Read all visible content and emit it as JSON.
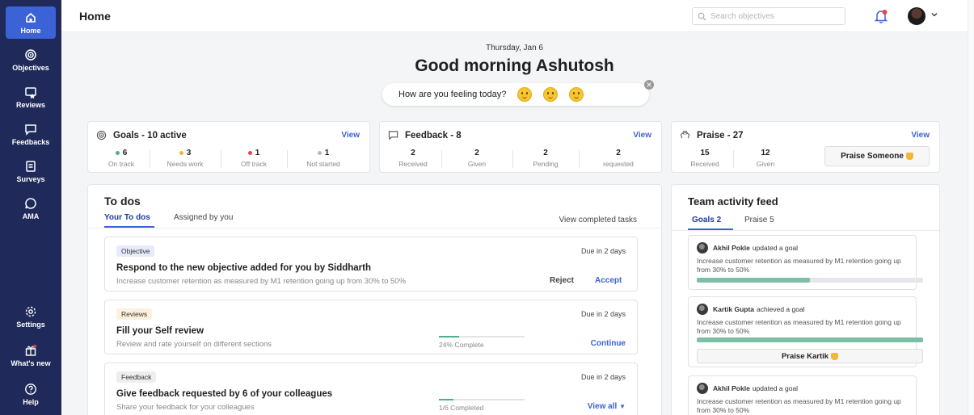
{
  "sidebar": {
    "items": [
      {
        "label": "Home",
        "icon": "home-icon"
      },
      {
        "label": "Objectives",
        "icon": "target-icon"
      },
      {
        "label": "Reviews",
        "icon": "reviews-icon"
      },
      {
        "label": "Feedbacks",
        "icon": "chat-icon"
      },
      {
        "label": "Surveys",
        "icon": "survey-icon"
      },
      {
        "label": "AMA",
        "icon": "ama-icon"
      }
    ],
    "bottom": [
      {
        "label": "Settings",
        "icon": "gear-icon"
      },
      {
        "label": "What's new",
        "icon": "gift-icon"
      },
      {
        "label": "Help",
        "icon": "help-icon"
      }
    ],
    "colors": {
      "bg": "#1f2a5a",
      "active": "#3b63d6"
    }
  },
  "header": {
    "title": "Home",
    "search_placeholder": "Search objectives"
  },
  "greeting": {
    "date": "Thursday, Jan 6",
    "message": "Good morning Ashutosh",
    "mood_question": "How are you feeling today?"
  },
  "goals_card": {
    "title": "Goals - 10 active",
    "view": "View",
    "stats": [
      {
        "value": "6",
        "label": "On track",
        "color": "#4db08a"
      },
      {
        "value": "3",
        "label": "Needs work",
        "color": "#f0b43c"
      },
      {
        "value": "1",
        "label": "Off track",
        "color": "#e04848"
      },
      {
        "value": "1",
        "label": "Not started",
        "color": "#b8b8b8"
      }
    ]
  },
  "feedback_card": {
    "title": "Feedback - 8",
    "view": "View",
    "stats": [
      {
        "value": "2",
        "label": "Received"
      },
      {
        "value": "2",
        "label": "Given"
      },
      {
        "value": "2",
        "label": "Pending"
      },
      {
        "value": "2",
        "label": "requested"
      }
    ]
  },
  "praise_card": {
    "title": "Praise - 27",
    "view": "View",
    "stats": [
      {
        "value": "15",
        "label": "Received"
      },
      {
        "value": "12",
        "label": "Given"
      }
    ],
    "button": "Praise Someone"
  },
  "todos": {
    "title": "To dos",
    "tabs": [
      "Your To dos",
      "Assigned by you"
    ],
    "view_completed": "View completed tasks",
    "items": [
      {
        "badge": "Objective",
        "due": "Due in 2 days",
        "title": "Respond to the new objective added for you by Siddharth",
        "subtitle": "Increase customer retention as measured by M1 retention going up from 30% to 50%",
        "actions": [
          "Reject",
          "Accept"
        ]
      },
      {
        "badge": "Reviews",
        "due": "Due in 2 days",
        "title": "Fill your Self review",
        "subtitle": "Review and rate yourself on different sections",
        "progress_label": "24% Complete",
        "progress": 0.24,
        "action": "Continue"
      },
      {
        "badge": "Feedback",
        "due": "Due in 2 days",
        "title": "Give feedback requested by 6 of your colleagues",
        "subtitle": "Share your feedback for your colleagues",
        "progress_label": "1/6 Completed",
        "progress": 0.17,
        "action": "View all"
      }
    ]
  },
  "feed": {
    "title": "Team activity feed",
    "tabs": [
      "Goals 2",
      "Praise 5"
    ],
    "items": [
      {
        "name": "Akhil Pokle",
        "action": "updated a goal",
        "text": "Increase customer retention as measured by M1 retention going up from 30% to 50%",
        "progress": 0.5
      },
      {
        "name": "Kartik Gupta",
        "action": "achieved a goal",
        "text": "Increase customer retention as measured by M1 retention going up from 30% to 50%",
        "progress": 1.0,
        "button": "Praise Kartik"
      },
      {
        "name": "Akhil Pokle",
        "action": "updated a goal",
        "text": "Increase customer retention as measured by M1 retention going up from 30% to 50%"
      }
    ]
  }
}
